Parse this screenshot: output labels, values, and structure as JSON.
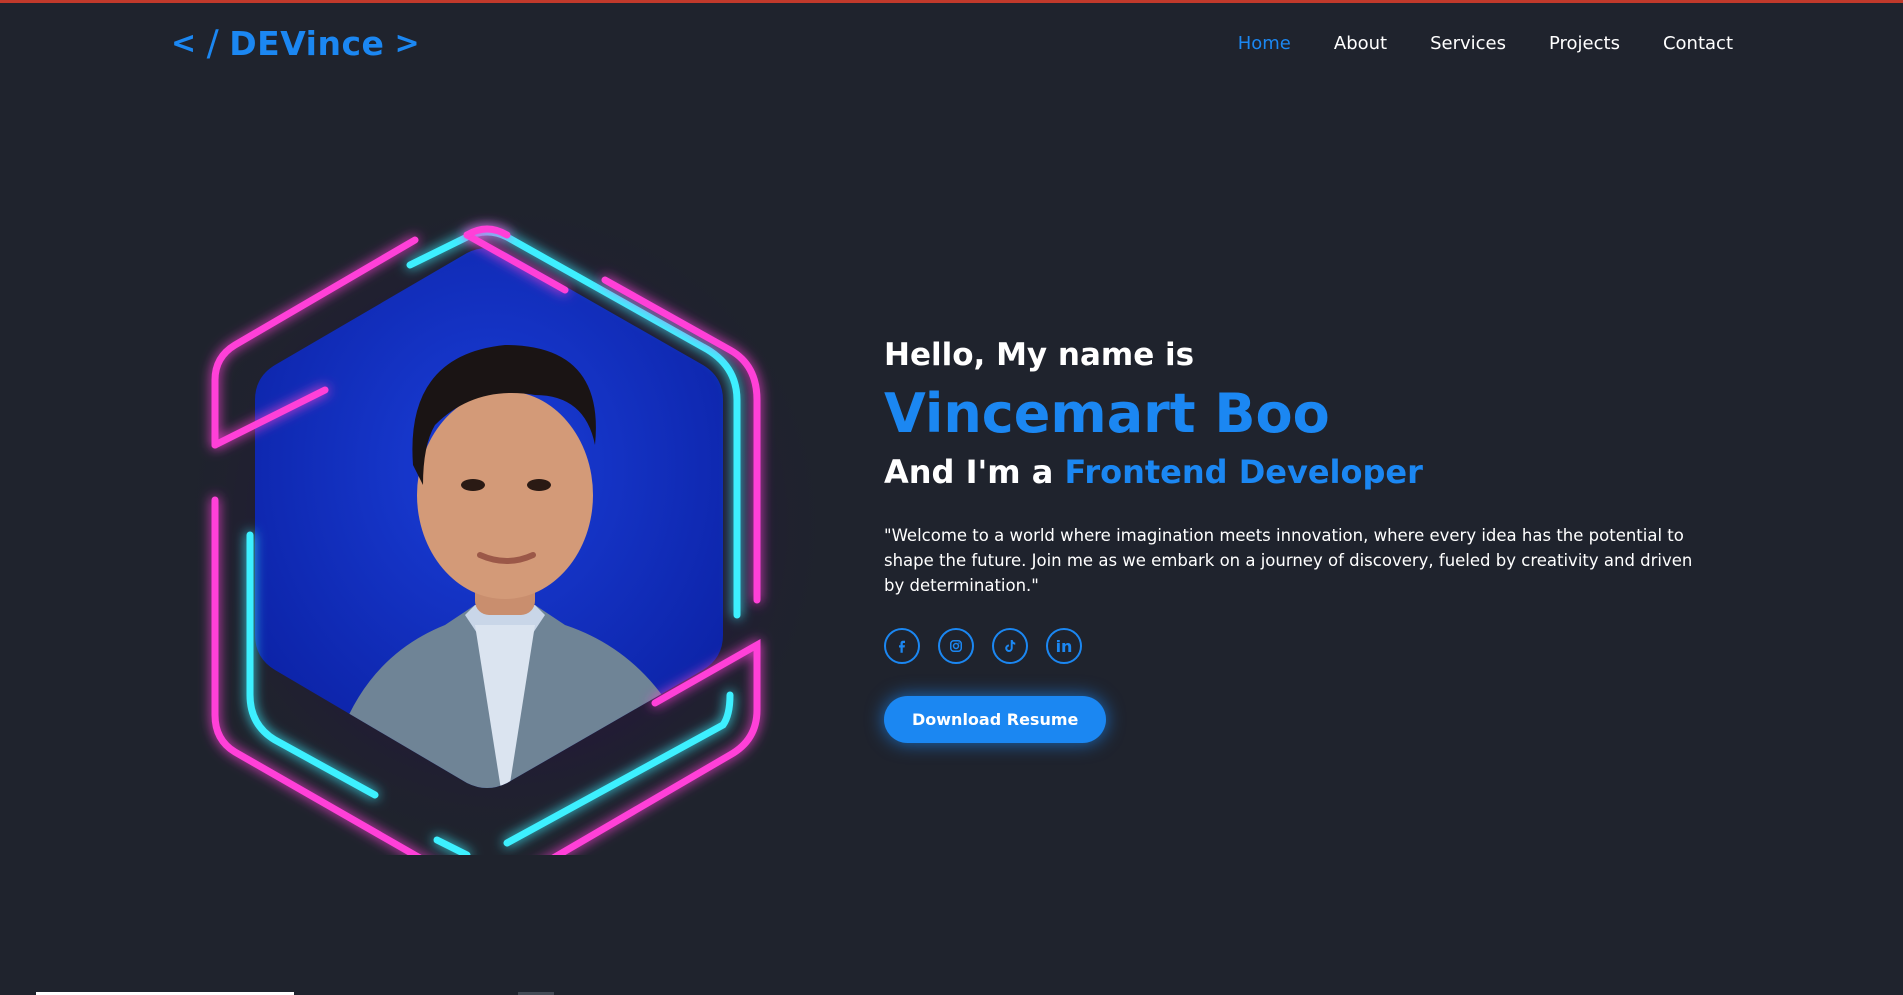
{
  "logo": {
    "open": "<",
    "slash": "/",
    "text": "DEVince",
    "close": ">"
  },
  "nav": {
    "items": [
      {
        "label": "Home",
        "active": true
      },
      {
        "label": "About",
        "active": false
      },
      {
        "label": "Services",
        "active": false
      },
      {
        "label": "Projects",
        "active": false
      },
      {
        "label": "Contact",
        "active": false
      }
    ]
  },
  "hero": {
    "greeting": "Hello, My name is",
    "name": "Vincemart Boo",
    "role_prefix": "And I'm a",
    "role": "Frontend Developer",
    "bio": "\"Welcome to a world where imagination meets innovation, where every idea has the potential to shape the future. Join me as we embark on a journey of discovery, fueled by creativity and driven by determination.\"",
    "socials": [
      {
        "name": "facebook-icon"
      },
      {
        "name": "instagram-icon"
      },
      {
        "name": "tiktok-icon"
      },
      {
        "name": "linkedin-icon",
        "glyph": "in"
      }
    ],
    "button": "Download Resume"
  },
  "colors": {
    "accent": "#1b87f2",
    "background": "#1f232d",
    "neon_pink": "#ff3fd8",
    "neon_cyan": "#3ef0ff"
  }
}
